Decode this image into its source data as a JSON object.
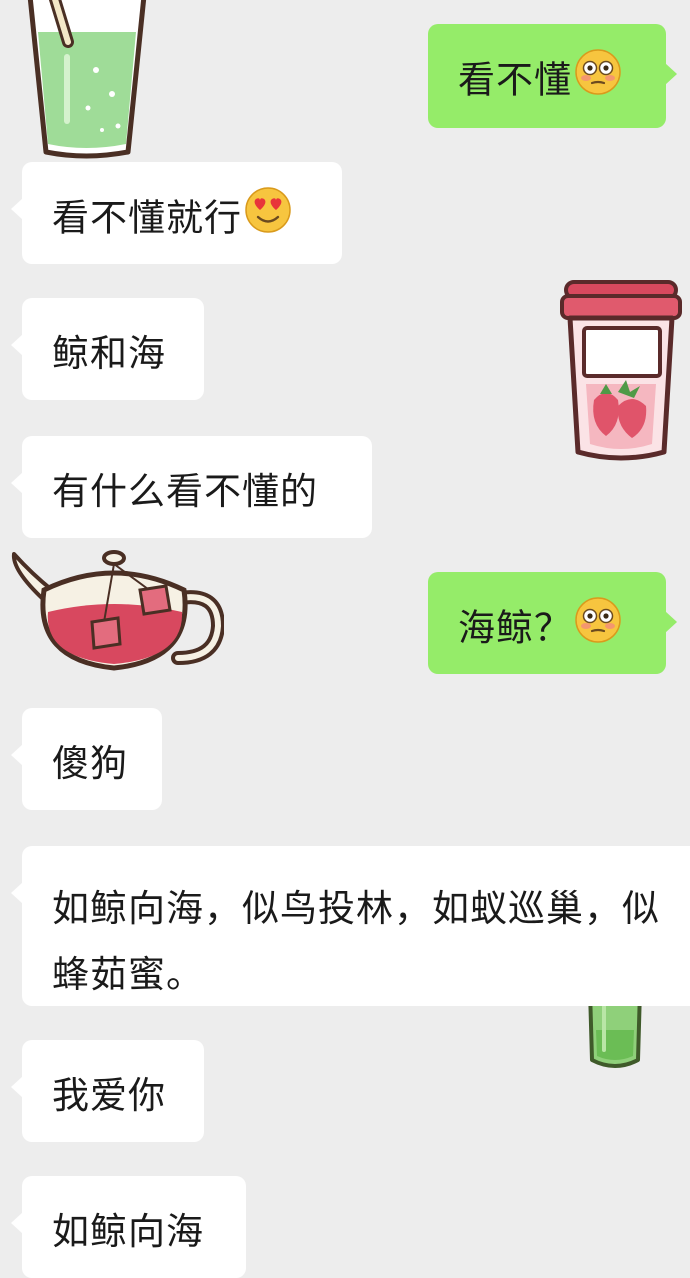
{
  "chat": {
    "messages": [
      {
        "side": "out",
        "text": "看不懂",
        "emoji": "flushed-face"
      },
      {
        "side": "in",
        "text": "看不懂就行",
        "emoji": "heart-eyes-face"
      },
      {
        "side": "in",
        "text": "鲸和海"
      },
      {
        "side": "in",
        "text": "有什么看不懂的"
      },
      {
        "side": "out",
        "text": "海鲸？",
        "emoji": "flushed-face"
      },
      {
        "side": "in",
        "text": "傻狗"
      },
      {
        "side": "in",
        "text": "如鲸向海，似鸟投林，如蚁巡巢，似蜂茹蜜。"
      },
      {
        "side": "in",
        "text": "我爱你"
      },
      {
        "side": "in",
        "text": "如鲸向海"
      }
    ],
    "stickers": [
      {
        "name": "green-drink-cup-sticker"
      },
      {
        "name": "strawberry-drink-cup-sticker"
      },
      {
        "name": "pink-teapot-sticker"
      },
      {
        "name": "green-bottle-sticker"
      }
    ]
  },
  "colors": {
    "background": "#ededed",
    "incoming_bubble": "#ffffff",
    "outgoing_bubble": "#95ec69",
    "text": "#1a1a1a"
  }
}
